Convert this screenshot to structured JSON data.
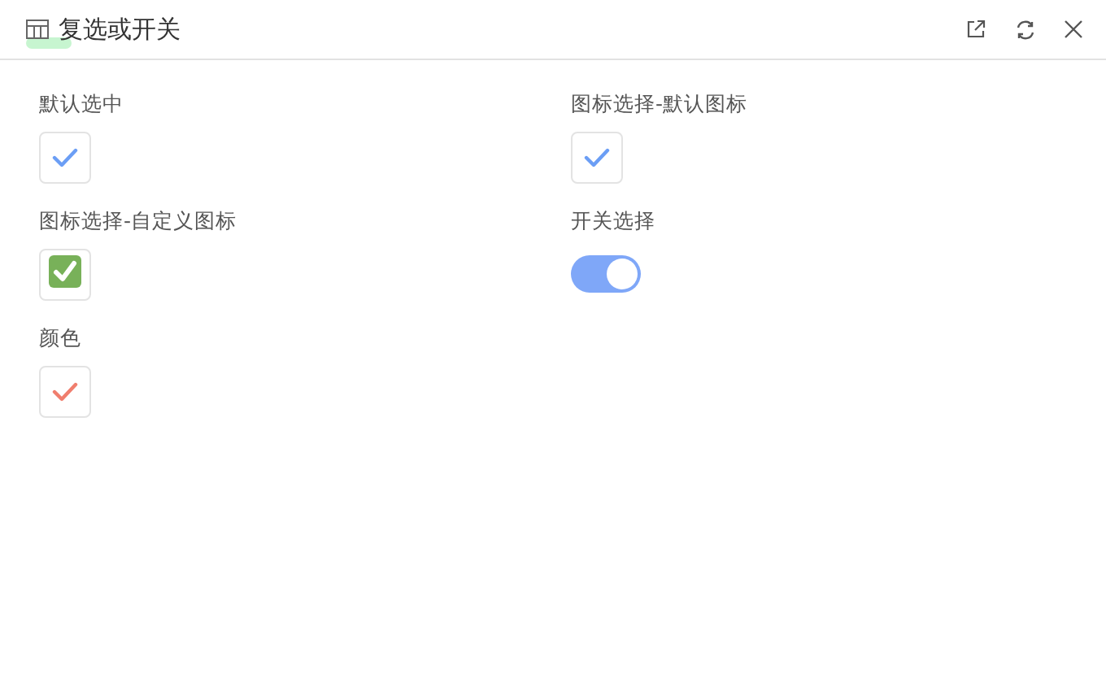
{
  "window": {
    "title": "复选或开关"
  },
  "fields": [
    {
      "label": "默认选中",
      "kind": "checkbox",
      "checked": true,
      "color": "#6b9ef5"
    },
    {
      "label": "图标选择-默认图标",
      "kind": "checkbox",
      "checked": true,
      "color": "#6b9ef5"
    },
    {
      "label": "图标选择-自定义图标",
      "kind": "custom-checkbox",
      "checked": true
    },
    {
      "label": "开关选择",
      "kind": "switch",
      "on": true
    },
    {
      "label": "颜色",
      "kind": "checkbox",
      "checked": true,
      "color": "#f07e6e"
    }
  ]
}
